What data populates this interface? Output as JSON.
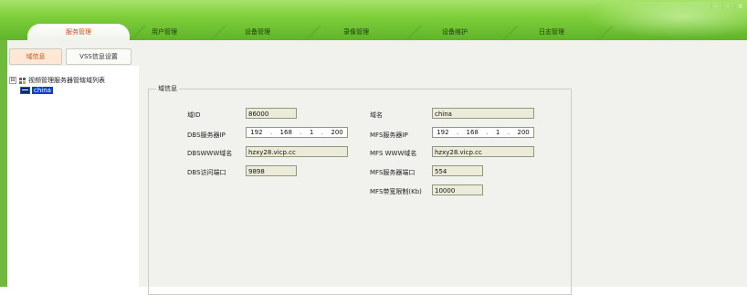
{
  "tabs": [
    {
      "label": "服务管理",
      "active": true
    },
    {
      "label": "用户管理",
      "active": false
    },
    {
      "label": "设备管理",
      "active": false
    },
    {
      "label": "录像管理",
      "active": false
    },
    {
      "label": "设备维护",
      "active": false
    },
    {
      "label": "日志管理",
      "active": false
    }
  ],
  "window_controls": {
    "minimize": "-",
    "restore": "-",
    "close": "x"
  },
  "subtabs": [
    {
      "label": "域信息",
      "active": true
    },
    {
      "label": "VSS信息设置",
      "active": false
    }
  ],
  "tree": {
    "root_label": "视频管理服务器管辖域列表",
    "root_expander": "⊟",
    "child_label": "china"
  },
  "domain_info": {
    "group_title": "域信息",
    "fields": {
      "domain_id_label": "域ID",
      "domain_id_value": "86000",
      "domain_name_label": "域名",
      "domain_name_value": "china",
      "dbs_ip_label": "DBS服务器IP",
      "dbs_ip_octets": [
        "192",
        "168",
        "1",
        "200"
      ],
      "mfs_ip_label": "MFS服务器IP",
      "mfs_ip_octets": [
        "192",
        "168",
        "1",
        "200"
      ],
      "dbs_www_label": "DBSWWW域名",
      "dbs_www_value": "hzxy28.vicp.cc",
      "mfs_www_label": "MFS WWW域名",
      "mfs_www_value": "hzxy28.vicp.cc",
      "dbs_port_label": "DBS访问端口",
      "dbs_port_value": "9898",
      "mfs_port_label": "MFS服务器端口",
      "mfs_port_value": "554",
      "mfs_bandwidth_label": "MFS带宽限制(Kb)",
      "mfs_bandwidth_value": "10000"
    }
  },
  "colors": {
    "top_green": "#7fcf3a",
    "active_tab_text": "#c8501f",
    "selected_node": "#0a3fd0",
    "readonly_field": "#ecebd9"
  }
}
